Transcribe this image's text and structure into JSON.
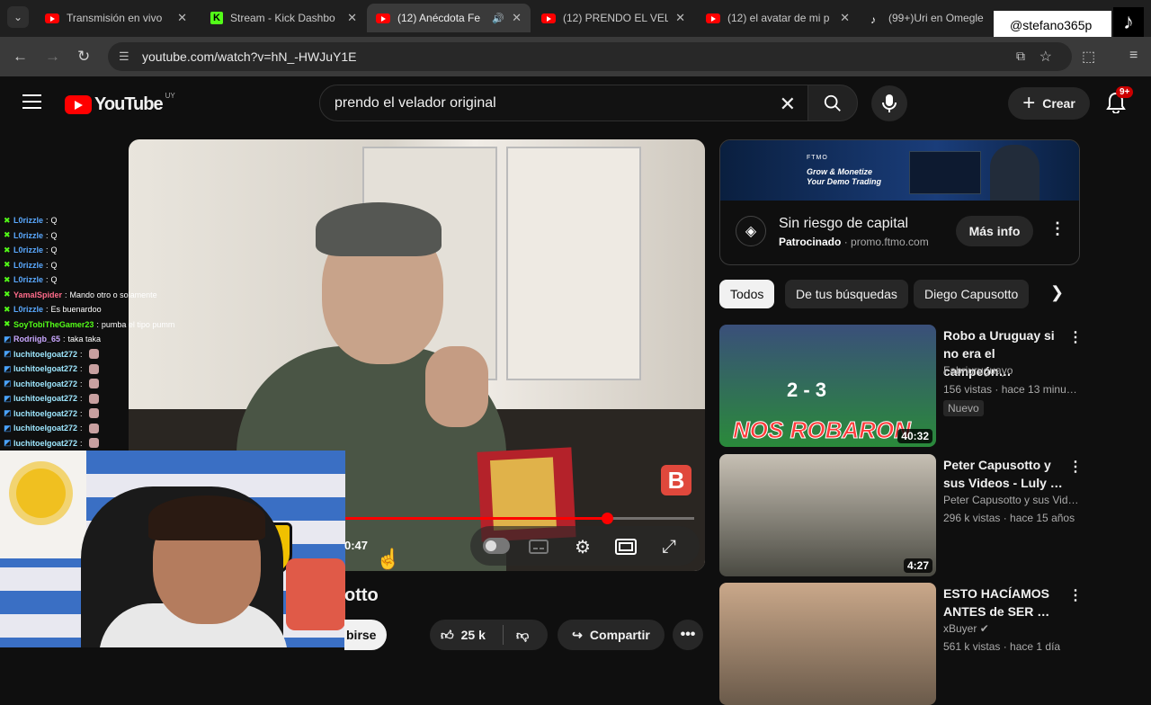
{
  "tabs": [
    {
      "title": "Transmisión en vivo",
      "favicon": "youtube-icon"
    },
    {
      "title": "Stream - Kick Dashbo",
      "favicon": "kick-icon"
    },
    {
      "title": "(12) Anécdota Fe",
      "favicon": "youtube-icon",
      "active": true,
      "audio": true
    },
    {
      "title": "(12) PRENDO EL VELA",
      "favicon": "youtube-icon"
    },
    {
      "title": "(12) el avatar de mi p",
      "favicon": "youtube-icon"
    },
    {
      "title": "(99+)Uri en Omegle",
      "favicon": "tiktok-icon"
    }
  ],
  "overlay": {
    "handle": "@stefano365p"
  },
  "address": {
    "url": "youtube.com/watch?v=hN_-HWJuY1E"
  },
  "header": {
    "logo_text": "YouTube",
    "logo_country": "UY",
    "search_value": "prendo el velador original",
    "create_label": "Crear",
    "notifications": "9+"
  },
  "player": {
    "time": "0:47",
    "progress_fraction": 0.75,
    "brand_letter": "B"
  },
  "video": {
    "title_fragment": "otto",
    "subscribe_fragment": "birse",
    "likes": "25 k",
    "share_label": "Compartir"
  },
  "chat": [
    {
      "user": "L0rizzle",
      "text": "Q",
      "color": "#5aa9ff",
      "icon": "kick"
    },
    {
      "user": "L0rizzle",
      "text": "Q",
      "color": "#5aa9ff",
      "icon": "kick"
    },
    {
      "user": "L0rizzle",
      "text": "Q",
      "color": "#5aa9ff",
      "icon": "kick"
    },
    {
      "user": "L0rizzle",
      "text": "Q",
      "color": "#5aa9ff",
      "icon": "kick"
    },
    {
      "user": "L0rizzle",
      "text": "Q",
      "color": "#5aa9ff",
      "icon": "kick"
    },
    {
      "user": "YamalSpider",
      "text": "Mando otro o solamente",
      "color": "#ff6b8a",
      "icon": "kick"
    },
    {
      "user": "L0rizzle",
      "text": "Es buenardoo",
      "color": "#5aa9ff",
      "icon": "kick"
    },
    {
      "user": "SoyTobiTheGamer23",
      "text": "pumba el tipo pumm",
      "color": "#53fc18",
      "icon": "kick"
    },
    {
      "user": "Rodriigb_65",
      "text": "taka taka",
      "color": "#c9a7ff",
      "icon": "kick2"
    },
    {
      "user": "luchitoelgoat272",
      "text": "",
      "color": "#9ee7ff",
      "icon": "kick2",
      "emote": true
    },
    {
      "user": "luchitoelgoat272",
      "text": "",
      "color": "#9ee7ff",
      "icon": "kick2",
      "emote": true
    },
    {
      "user": "luchitoelgoat272",
      "text": "",
      "color": "#9ee7ff",
      "icon": "kick2",
      "emote": true
    },
    {
      "user": "luchitoelgoat272",
      "text": "",
      "color": "#9ee7ff",
      "icon": "kick2",
      "emote": true
    },
    {
      "user": "luchitoelgoat272",
      "text": "",
      "color": "#9ee7ff",
      "icon": "kick2",
      "emote": true
    },
    {
      "user": "luchitoelgoat272",
      "text": "",
      "color": "#9ee7ff",
      "icon": "kick2",
      "emote": true
    },
    {
      "user": "luchitoelgoat272",
      "text": "",
      "color": "#9ee7ff",
      "icon": "kick2",
      "emote": true
    }
  ],
  "ad": {
    "banner_logo": "FTMO",
    "banner_line1": "Grow & Monetize",
    "banner_line2": "Your Demo Trading",
    "title": "Sin riesgo de capital",
    "sponsored": "Patrocinado",
    "domain": "promo.ftmo.com",
    "cta": "Más info"
  },
  "chips": [
    "Todos",
    "De tus búsquedas",
    "Diego Capusotto"
  ],
  "recommendations": [
    {
      "title": "Robo a Uruguay si no era el campeón…",
      "channel": "Fabriuruguayo",
      "meta": "156 vistas · hace 13 minu…",
      "badge": "Nuevo",
      "duration": "40:32",
      "thumb_text": "NOS ROBARON",
      "score": "2 - 3"
    },
    {
      "title": "Peter Capusotto y sus Videos - Luly …",
      "channel": "Peter Capusotto y sus Vid…",
      "meta": "296 k vistas · hace 15 años",
      "duration": "4:27"
    },
    {
      "title": "ESTO HACÍAMOS ANTES de SER …",
      "channel": "xBuyer",
      "meta": "561 k vistas · hace 1 día",
      "verified": true
    }
  ]
}
